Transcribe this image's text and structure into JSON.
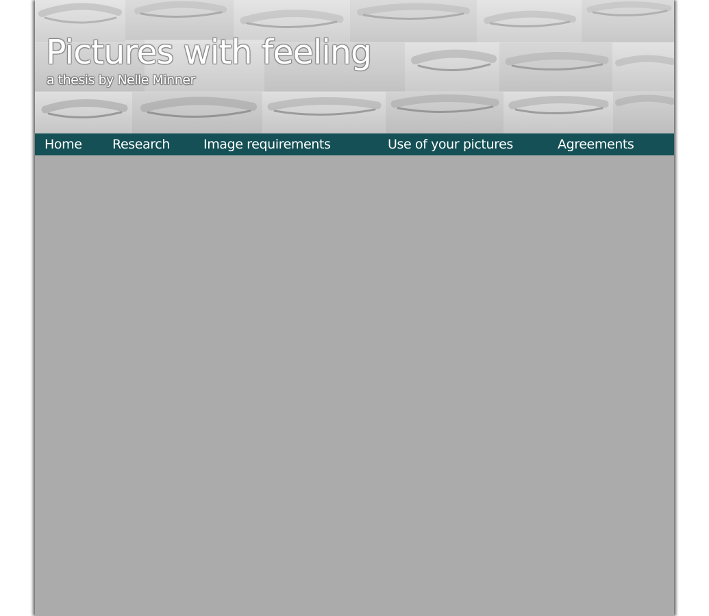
{
  "header": {
    "title": "Pictures with feeling",
    "subtitle": "a thesis by Nelle Minner"
  },
  "nav": {
    "items": [
      {
        "label": "Home"
      },
      {
        "label": "Research"
      },
      {
        "label": "Image requirements"
      },
      {
        "label": "Use of your pictures"
      },
      {
        "label": "Agreements"
      }
    ]
  },
  "colors": {
    "page_background": "#ababab",
    "nav_background": "#145055",
    "nav_text": "#ffffff"
  }
}
